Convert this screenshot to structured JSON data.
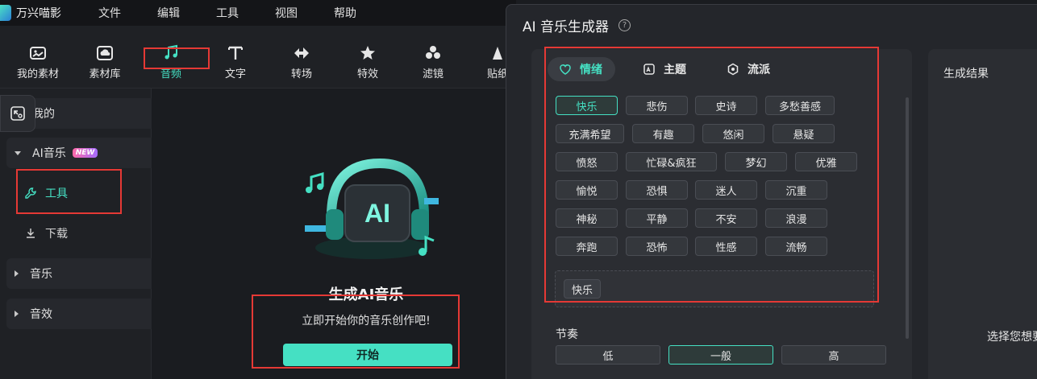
{
  "app": {
    "name": "万兴喵影"
  },
  "menu": [
    "文件",
    "编辑",
    "工具",
    "视图",
    "帮助"
  ],
  "toolbar": [
    {
      "label": "我的素材",
      "icon": "media-icon"
    },
    {
      "label": "素材库",
      "icon": "stock-cloud-icon"
    },
    {
      "label": "音频",
      "icon": "music-note-icon",
      "active": true
    },
    {
      "label": "文字",
      "icon": "text-icon"
    },
    {
      "label": "转场",
      "icon": "transition-icon"
    },
    {
      "label": "特效",
      "icon": "effects-star-icon"
    },
    {
      "label": "滤镜",
      "icon": "filter-icon"
    },
    {
      "label": "贴纸",
      "icon": "sticker-icon"
    }
  ],
  "sidebar": {
    "mine": "我的",
    "ai_music": "AI音乐",
    "new_badge": "NEW",
    "tools": "工具",
    "download": "下载",
    "music": "音乐",
    "sfx": "音效"
  },
  "empty_state": {
    "title": "生成AI音乐",
    "subtitle": "立即开始你的音乐创作吧!",
    "button": "开始"
  },
  "dialog": {
    "title": "AI 音乐生成器",
    "help": "?",
    "tabs": [
      {
        "label": "情绪",
        "icon": "emotion-icon",
        "active": true
      },
      {
        "label": "主题",
        "icon": "theme-icon"
      },
      {
        "label": "流派",
        "icon": "genre-icon"
      }
    ],
    "moods": [
      [
        "快乐",
        "悲伤",
        "史诗",
        "多愁善感"
      ],
      [
        "充满希望",
        "有趣",
        "悠闲",
        "悬疑"
      ],
      [
        "愤怒",
        "忙碌&疯狂",
        "梦幻",
        "优雅"
      ],
      [
        "愉悦",
        "恐惧",
        "迷人",
        "沉重"
      ],
      [
        "神秘",
        "平静",
        "不安",
        "浪漫"
      ],
      [
        "奔跑",
        "恐怖",
        "性感",
        "流畅"
      ]
    ],
    "selected_mood": "快乐",
    "selected_chip": "快乐",
    "tempo_label": "节奏",
    "tempo_options": [
      "低",
      "一般",
      "高"
    ],
    "tempo_selected": "一般",
    "result_title": "生成结果",
    "result_hint": "选择您想要"
  },
  "colors": {
    "accent": "#45e0c3",
    "highlight_box": "#e53935"
  }
}
